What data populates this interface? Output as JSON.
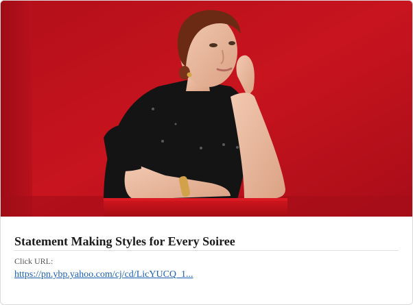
{
  "card": {
    "image_alt": "Woman in black top leaning on red block against red background",
    "title": "Statement Making Styles for Every Soiree",
    "url_label": "Click URL:",
    "url": "https://pn.ybp.yahoo.com/cj/cd/LicYUCQ_1..."
  },
  "colors": {
    "backdrop": "#c0121e",
    "link": "#1a5fb4"
  }
}
